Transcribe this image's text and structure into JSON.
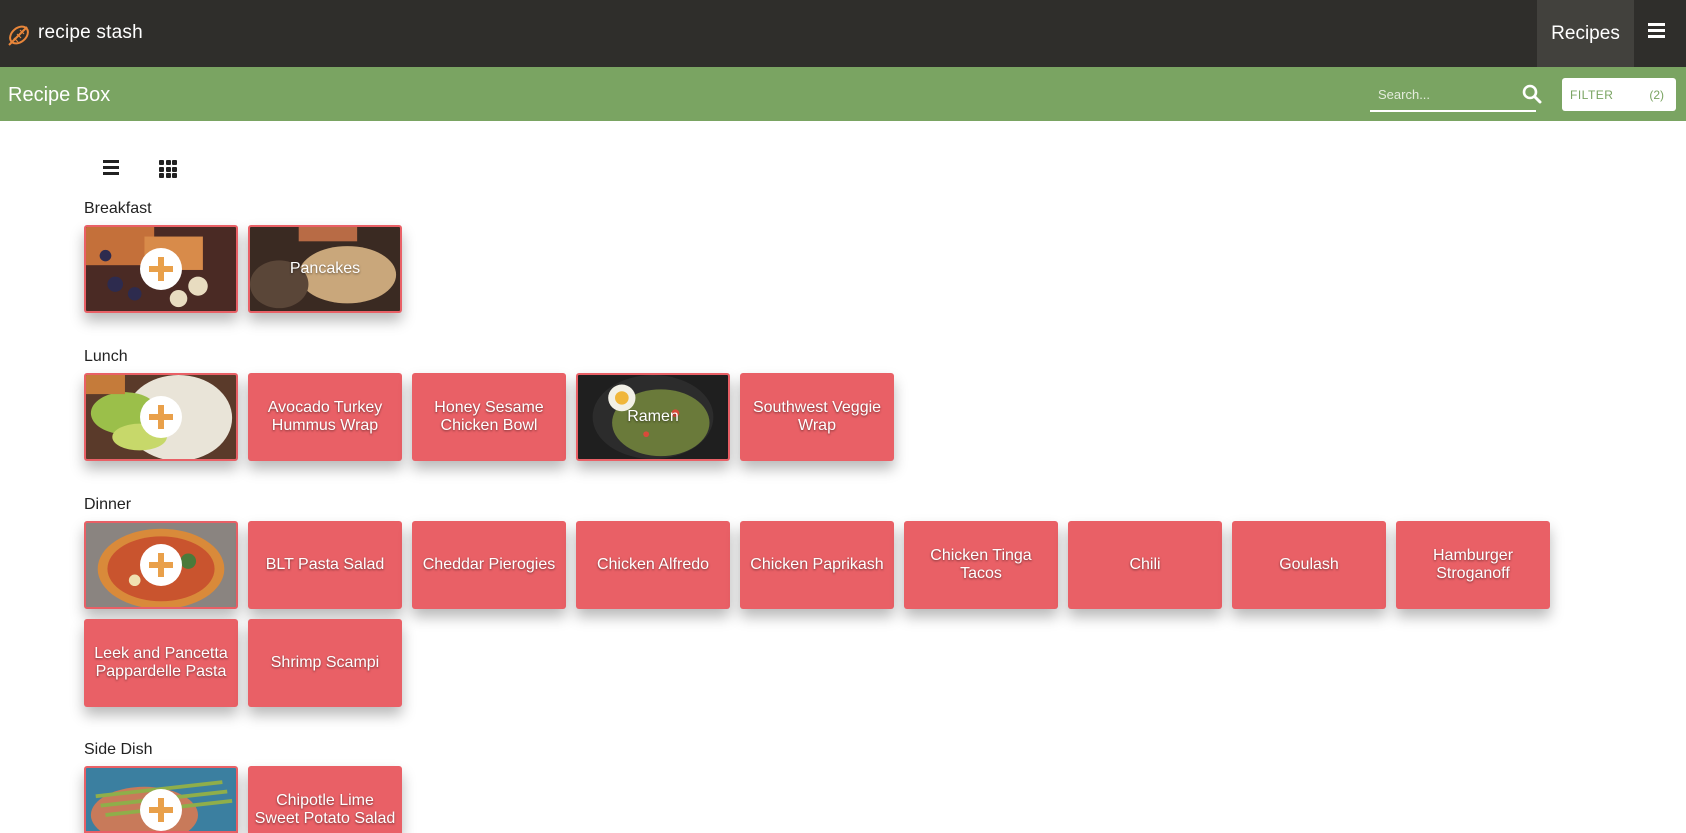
{
  "header": {
    "app_name": "recipe stash",
    "nav_recipes": "Recipes"
  },
  "subheader": {
    "title": "Recipe Box",
    "search_placeholder": "Search...",
    "filter_label": "FILTER",
    "filter_count": "(2)"
  },
  "sections": [
    {
      "title": "Breakfast",
      "recipes": [
        "Pancakes"
      ]
    },
    {
      "title": "Lunch",
      "recipes": [
        "Avocado Turkey Hummus Wrap",
        "Honey Sesame Chicken Bowl",
        "Ramen",
        "Southwest Veggie Wrap"
      ]
    },
    {
      "title": "Dinner",
      "recipes": [
        "BLT Pasta Salad",
        "Cheddar Pierogies",
        "Chicken Alfredo",
        "Chicken Paprikash",
        "Chicken Tinga Tacos",
        "Chili",
        "Goulash",
        "Hamburger Stroganoff",
        "Leek and Pancetta Pappardelle Pasta",
        "Shrimp Scampi"
      ]
    },
    {
      "title": "Side Dish",
      "recipes": [
        "Chipotle Lime Sweet Potato Salad"
      ]
    }
  ],
  "colors": {
    "topbar": "#2f2e2b",
    "subbar": "#7aa462",
    "card": "#e96066",
    "accent": "#e9a04a"
  }
}
